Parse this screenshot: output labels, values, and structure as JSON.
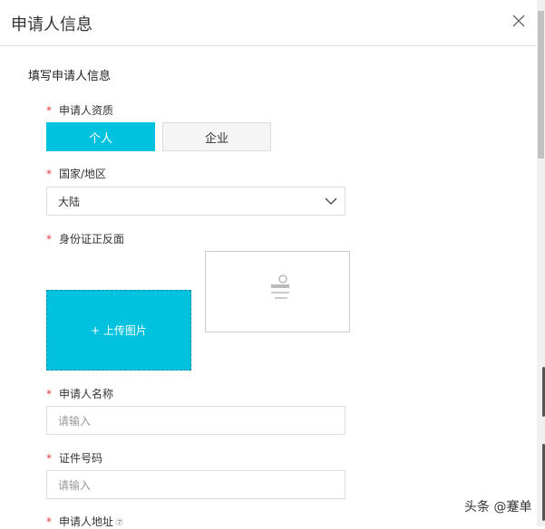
{
  "dialog": {
    "title": "申请人信息",
    "close_icon": "close-icon"
  },
  "section_title": "填写申请人信息",
  "required_mark": "*",
  "qualification": {
    "label": "申请人资质",
    "options": [
      "个人",
      "企业"
    ],
    "selected": "个人"
  },
  "region": {
    "label": "国家/地区",
    "value": "大陆"
  },
  "id_card": {
    "label": "身份证正反面",
    "upload_label": "+ 上传图片"
  },
  "name": {
    "label": "申请人名称",
    "placeholder": "请输入"
  },
  "id_number": {
    "label": "证件号码",
    "placeholder": "请输入"
  },
  "address": {
    "label": "申请人地址",
    "help": "⑦"
  },
  "watermark": "头条 @蹇单",
  "colors": {
    "accent": "#00c1de",
    "required": "#e4393c"
  }
}
